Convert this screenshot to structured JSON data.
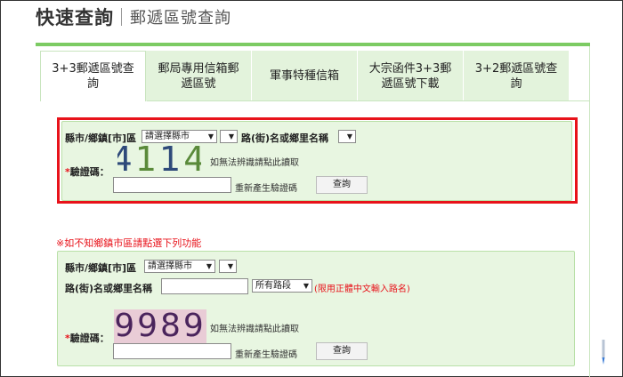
{
  "header": {
    "title": "快速查詢",
    "subtitle": "郵遞區號查詢"
  },
  "tabs": [
    {
      "label": "3+3郵遞區號查詢",
      "active": true
    },
    {
      "label": "郵局專用信箱郵遞區號",
      "active": false
    },
    {
      "label": "軍事特種信箱",
      "active": false
    },
    {
      "label": "大宗函件3+3郵遞區號下載",
      "active": false
    },
    {
      "label": "3+2郵遞區號查詢",
      "active": false
    }
  ],
  "form1": {
    "county_label": "縣市/鄉鎮[市]區",
    "county_select": "請選擇縣市",
    "road_label": "路(街)名或鄉里名稱",
    "captcha_label": "驗證碼：",
    "captcha_code": "4114",
    "captcha_hint": "如無法辨識請點此讀取",
    "regen_link": "重新產生驗證碼",
    "submit": "查詢"
  },
  "note": "※如不知鄉鎮市區請點選下列功能",
  "form2": {
    "county_label": "縣市/鄉鎮[市]區",
    "county_select": "請選擇縣市",
    "road_label": "路(街)名或鄉里名稱",
    "section_select": "所有路段",
    "chinese_note": "(限用正體中文輸入路名)",
    "captcha_label": "驗證碼：",
    "captcha_code": "9989",
    "captcha_hint": "如無法辨識請點此讀取",
    "regen_link": "重新產生驗證碼",
    "submit": "查詢"
  },
  "colors": {
    "accent_green": "#7ccb63",
    "highlight_red": "#e8121a",
    "panel_bg": "#e8f6e1"
  },
  "icons": {
    "dropdown": "chevron-down-icon"
  }
}
